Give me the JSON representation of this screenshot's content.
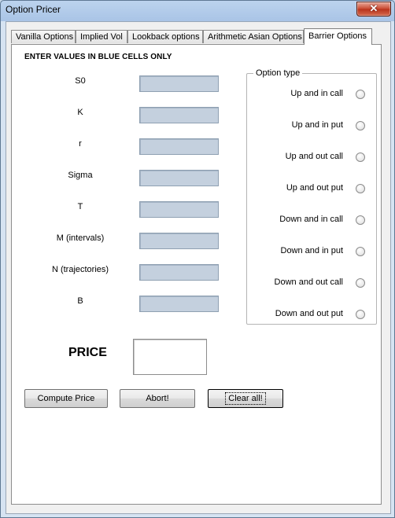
{
  "window": {
    "title": "Option Pricer",
    "close_glyph": "✕"
  },
  "tabs": [
    {
      "label": "Vanilla Options",
      "active": false
    },
    {
      "label": "Implied Vol",
      "active": false
    },
    {
      "label": "Lookback options",
      "active": false
    },
    {
      "label": "Arithmetic Asian Options",
      "active": false
    },
    {
      "label": "Barrier Options",
      "active": true
    }
  ],
  "panel": {
    "instruction": "ENTER VALUES IN BLUE CELLS ONLY",
    "input_color": "#c4d0de",
    "fields": [
      {
        "label": "S0",
        "value": ""
      },
      {
        "label": "K",
        "value": ""
      },
      {
        "label": "r",
        "value": ""
      },
      {
        "label": "Sigma",
        "value": ""
      },
      {
        "label": "T",
        "value": ""
      },
      {
        "label": "M (intervals)",
        "value": ""
      },
      {
        "label": "N (trajectories)",
        "value": ""
      },
      {
        "label": "B",
        "value": ""
      }
    ],
    "option_type": {
      "legend": "Option type",
      "options": [
        "Up and in call",
        "Up and in put",
        "Up and out call",
        "Up and out put",
        "Down and in call",
        "Down and in put",
        "Down and out call",
        "Down and out put"
      ]
    },
    "price": {
      "label": "PRICE",
      "value": ""
    },
    "buttons": {
      "compute": "Compute Price",
      "abort": "Abort!",
      "clear": "Clear all!"
    }
  }
}
